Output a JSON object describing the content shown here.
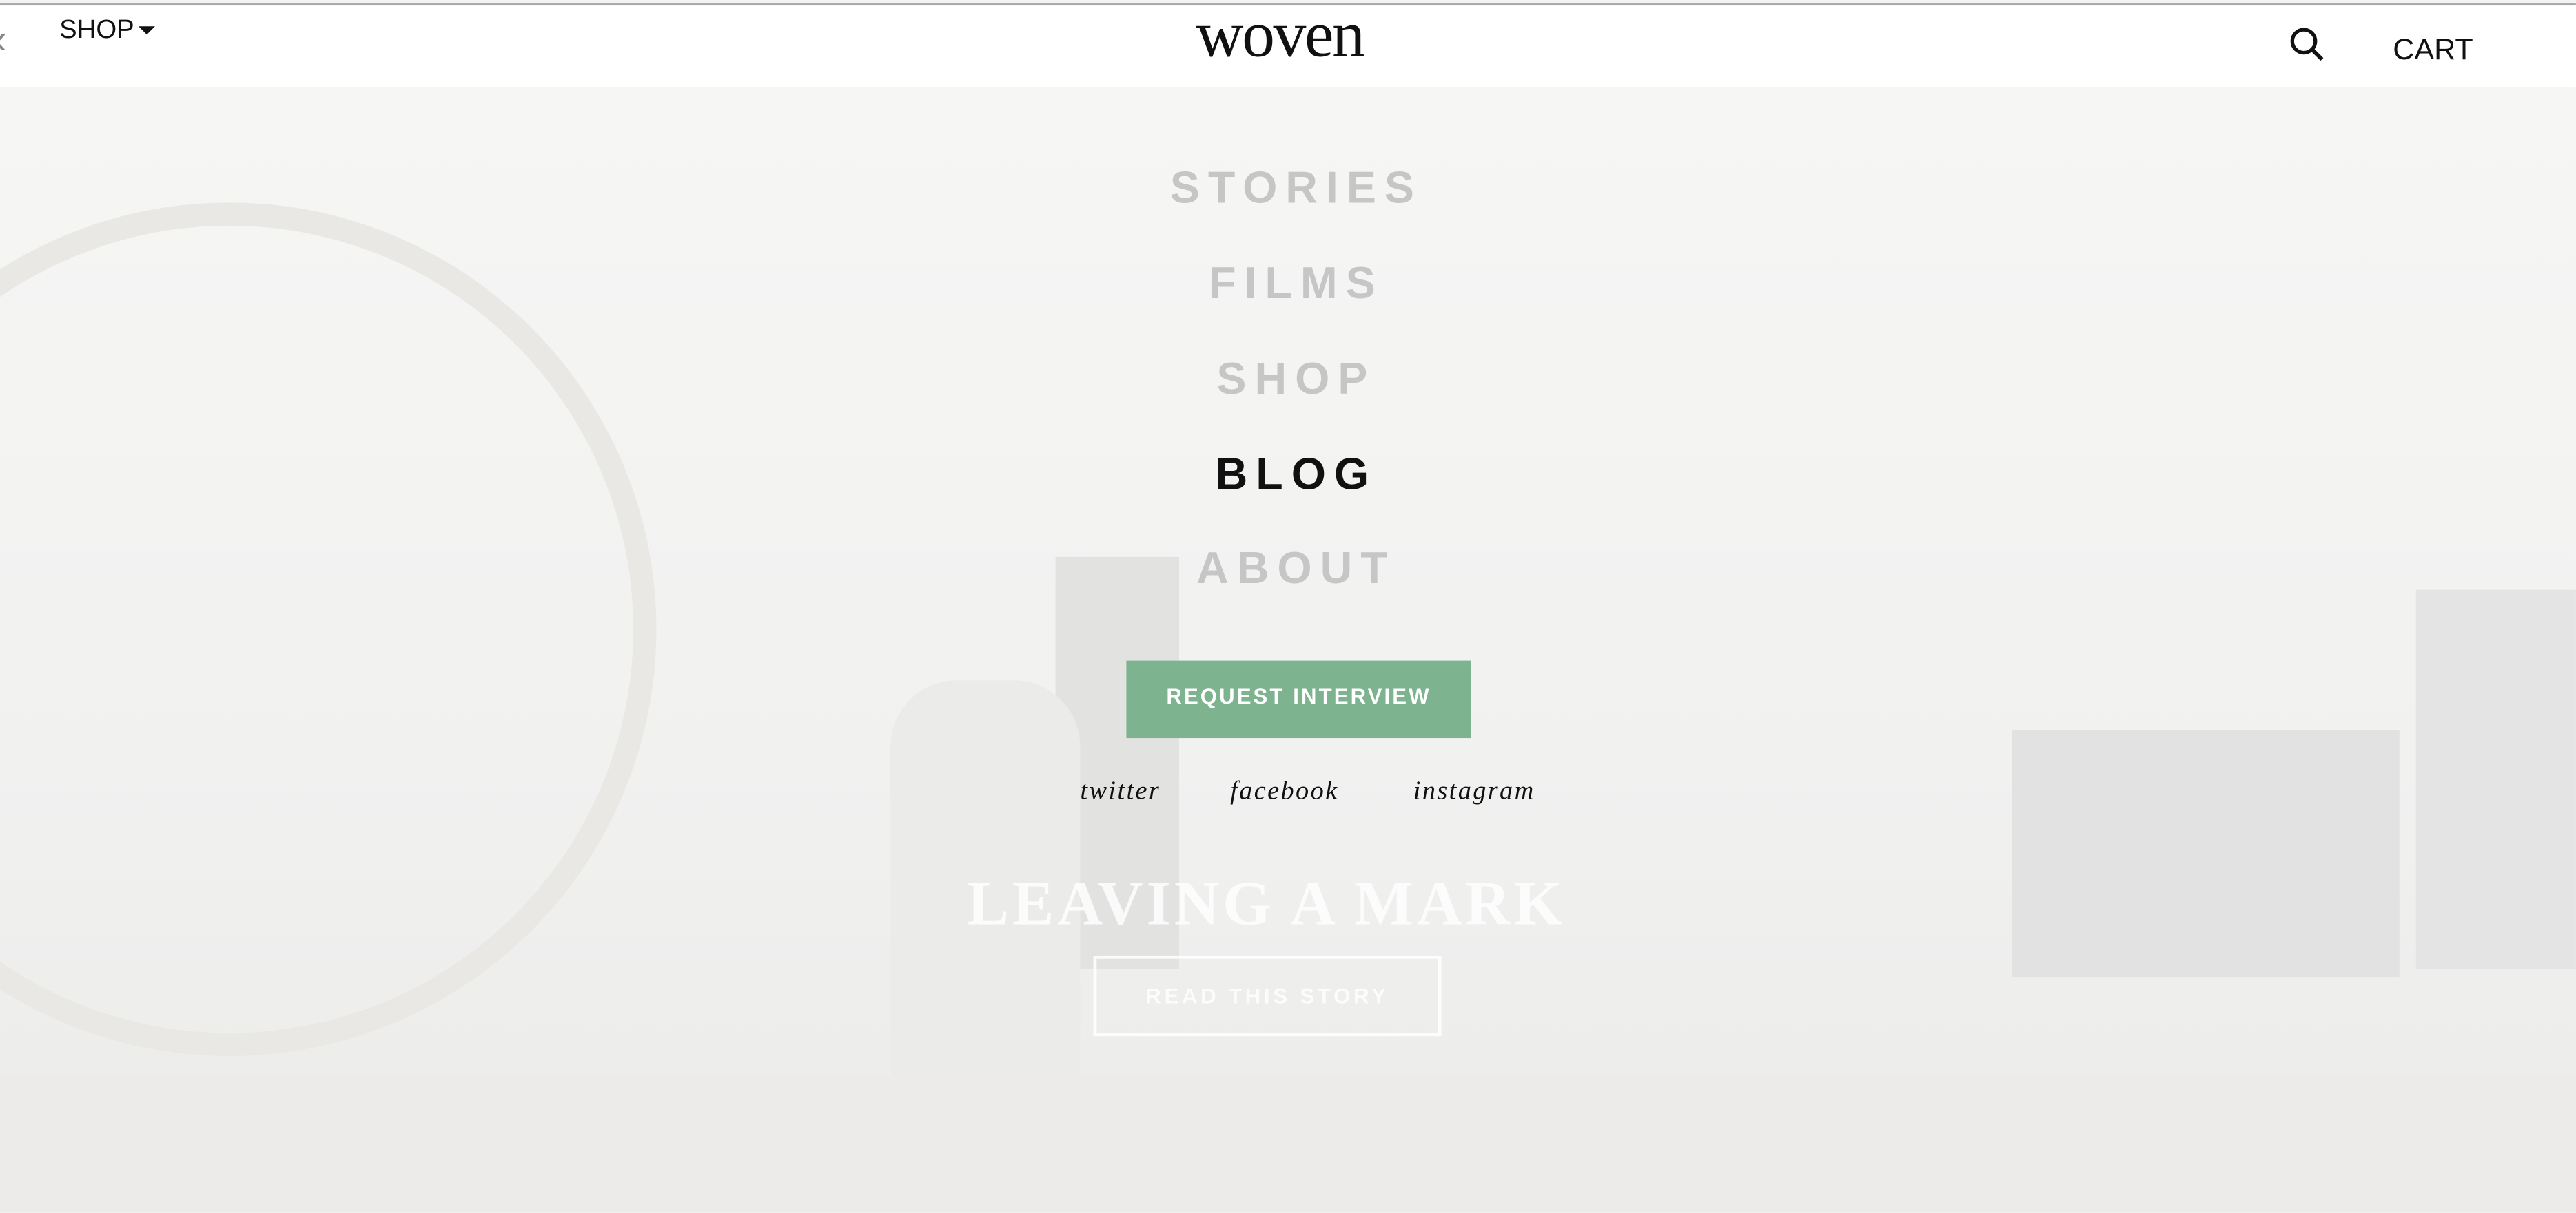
{
  "header": {
    "back_icon": "chevron-left-icon",
    "shop_label": "SHOP",
    "logo": "woven",
    "search_icon": "search-icon",
    "cart_label": "CART"
  },
  "menu": {
    "items": [
      {
        "label": "STORIES",
        "active": false
      },
      {
        "label": "FILMS",
        "active": false
      },
      {
        "label": "SHOP",
        "active": false
      },
      {
        "label": "BLOG",
        "active": true
      },
      {
        "label": "ABOUT",
        "active": false
      }
    ],
    "cta_label": "REQUEST INTERVIEW",
    "social": [
      "twitter",
      "facebook",
      "instagram"
    ]
  },
  "hero": {
    "title": "LEAVING A MARK",
    "button_label": "READ THIS STORY"
  },
  "colors": {
    "accent": "#7db38e",
    "menu_inactive": "#c6c6c6",
    "menu_active": "#111111"
  }
}
